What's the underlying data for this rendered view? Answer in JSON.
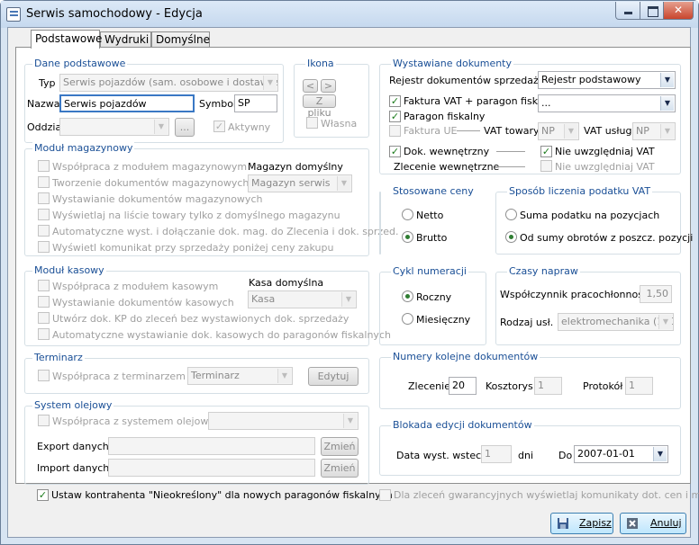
{
  "window": {
    "title": "Serwis samochodowy - Edycja",
    "close_symbol": "✕"
  },
  "tabs": [
    "Podstawowe",
    "Wydruki",
    "Domyślne"
  ],
  "dane": {
    "title": "Dane podstawowe",
    "typ_label": "Typ",
    "typ_value": "Serwis pojazdów (sam. osobowe i dostawcze)",
    "nazwa_label": "Nazwa",
    "nazwa_value": "Serwis pojazdów",
    "symbol_label": "Symbol",
    "symbol_value": "SP",
    "oddzial_label": "Oddział",
    "oddzial_btn": "...",
    "aktywny_label": "Aktywny"
  },
  "ikona": {
    "title": "Ikona",
    "prev": "<",
    "next": ">",
    "zpliku": "Z pliku",
    "wlasna": "Własna"
  },
  "magazyn": {
    "title": "Moduł magazynowy",
    "opts": [
      "Współpraca z modułem magazynowym",
      "Tworzenie dokumentów magazynowych",
      "Wystawianie dokumentów magazynowych",
      "Wyświetlaj na liście towary tylko z domyślnego magazynu",
      "Automatyczne wyst. i dołączanie dok. mag. do Zlecenia i dok. sprzed.",
      "Wyświetl komunikat przy sprzedaży poniżej ceny zakupu"
    ],
    "domyslny_label": "Magazyn domyślny",
    "domyslny_value": "Magazyn serwis"
  },
  "kasa": {
    "title": "Moduł kasowy",
    "opts": [
      "Współpraca z modułem kasowym",
      "Wystawianie dokumentów kasowych",
      "Utwórz dok. KP do zleceń bez wystawionych dok. sprzedaży",
      "Automatyczne wystawianie dok. kasowych do paragonów fiskalnych"
    ],
    "domyslna_label": "Kasa domyślna",
    "domyslna_value": "Kasa"
  },
  "terminarz": {
    "title": "Terminarz",
    "opt": "Współpraca z terminarzem",
    "combo": "Terminarz",
    "edytuj": "Edytuj"
  },
  "olej": {
    "title": "System olejowy",
    "opt": "Współpraca z systemem olejowym",
    "export_label": "Export danych:",
    "import_label": "Import danych:",
    "zmien": "Zmień"
  },
  "ustaw_label": "Ustaw kontrahenta \"Nieokreślony\" dla nowych paragonów fiskalnych",
  "gwarancja_label": "Dla zleceń gwarancyjnych wyświetlaj komunikaty dot. cen i marży",
  "wyst": {
    "title": "Wystawiane dokumenty",
    "rejestr_label": "Rejestr dokumentów sprzedaży",
    "rejestr_value": "Rejestr podstawowy",
    "faktura_par": "Faktura VAT + paragon fisk.",
    "faktura_par_value": "...",
    "paragon": "Paragon fiskalny",
    "faktura_ue": "Faktura UE",
    "vat_towary_label": "VAT towary",
    "vat_towary_value": "NP",
    "vat_uslugi_label": "VAT usługi",
    "vat_uslugi_value": "NP",
    "dok_wew": "Dok. wewnętrzny",
    "nie_vat": "Nie uwzględniaj VAT",
    "zlec_wew": "Zlecenie wewnętrzne",
    "nie_vat2": "Nie uwzględniaj VAT"
  },
  "ceny": {
    "title": "Stosowane ceny",
    "netto": "Netto",
    "brutto": "Brutto"
  },
  "vat": {
    "title": "Sposób liczenia podatku VAT",
    "suma": "Suma podatku na pozycjach",
    "od_sumy": "Od sumy obrotów z poszcz. pozycji"
  },
  "cykl": {
    "title": "Cykl numeracji",
    "roczny": "Roczny",
    "miesieczny": "Miesięczny"
  },
  "czasy": {
    "title": "Czasy napraw",
    "wsp_label": "Współczynnik pracochłonności",
    "wsp_value": "1,50",
    "rodzaj_label": "Rodzaj usł.",
    "rodzaj_value": "elektromechanika (100%)"
  },
  "numery": {
    "title": "Numery kolejne dokumentów",
    "zlecenie_label": "Zlecenie",
    "zlecenie_value": "20",
    "kosztorys_label": "Kosztorys",
    "kosztorys_value": "1",
    "protokol_label": "Protokół",
    "protokol_value": "1"
  },
  "blokada": {
    "title": "Blokada edycji dokumentów",
    "data_label": "Data wyst. wstecz",
    "data_value": "1",
    "dni": "dni",
    "do_label": "Do",
    "do_value": "2007-01-01"
  },
  "footer": {
    "zapisz": "Zapisz",
    "anuluj": "Anuluj"
  },
  "colors": {
    "group_title": "#1a4f96",
    "check": "#1a7a1a",
    "radio": "#2e7d32"
  }
}
